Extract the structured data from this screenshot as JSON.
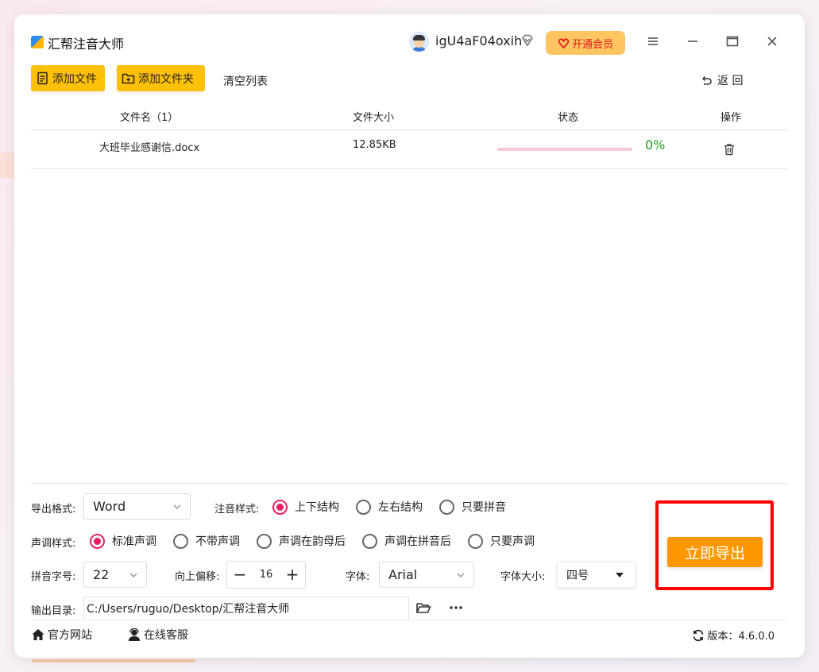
{
  "app": {
    "title": "汇帮注音大师",
    "username": "igU4aF04oxih",
    "vip_label": "开通会员"
  },
  "toolbar": {
    "add_file": "添加文件",
    "add_folder": "添加文件夹",
    "clear_list": "清空列表",
    "back": "返 回"
  },
  "table": {
    "columns": [
      "文件名（1）",
      "文件大小",
      "状态",
      "操作"
    ],
    "rows": [
      {
        "name": "大班毕业感谢信.docx",
        "size": "12.85KB",
        "progress_text": "0%",
        "progress": 0
      }
    ]
  },
  "settings": {
    "export_format_label": "导出格式:",
    "export_format_value": "Word",
    "annotation_style_label": "注音样式:",
    "annotation_options": [
      "上下结构",
      "左右结构",
      "只要拼音"
    ],
    "annotation_selected": 0,
    "tone_style_label": "声调样式:",
    "tone_options": [
      "标准声调",
      "不带声调",
      "声调在韵母后",
      "声调在拼音后",
      "只要声调"
    ],
    "tone_selected": 0,
    "pinyin_size_label": "拼音字号:",
    "pinyin_size_value": "22",
    "offset_label": "向上偏移:",
    "offset_value": "16",
    "font_label": "字体:",
    "font_value": "Arial",
    "font_size_label": "字体大小:",
    "font_size_value": "四号",
    "output_dir_label": "输出目录:",
    "output_dir_value": "C:/Users/ruguo/Desktop/汇帮注音大师"
  },
  "export_button": "立即导出",
  "footer": {
    "website": "官方网站",
    "support": "在线客服",
    "version": "版本：4.6.0.0"
  },
  "colors": {
    "accent_yellow": "#ffc107",
    "export_orange": "#ff9800",
    "radio_pink": "#e91e63",
    "progress_green": "#1aa01a",
    "highlight_red": "#ff0000"
  }
}
